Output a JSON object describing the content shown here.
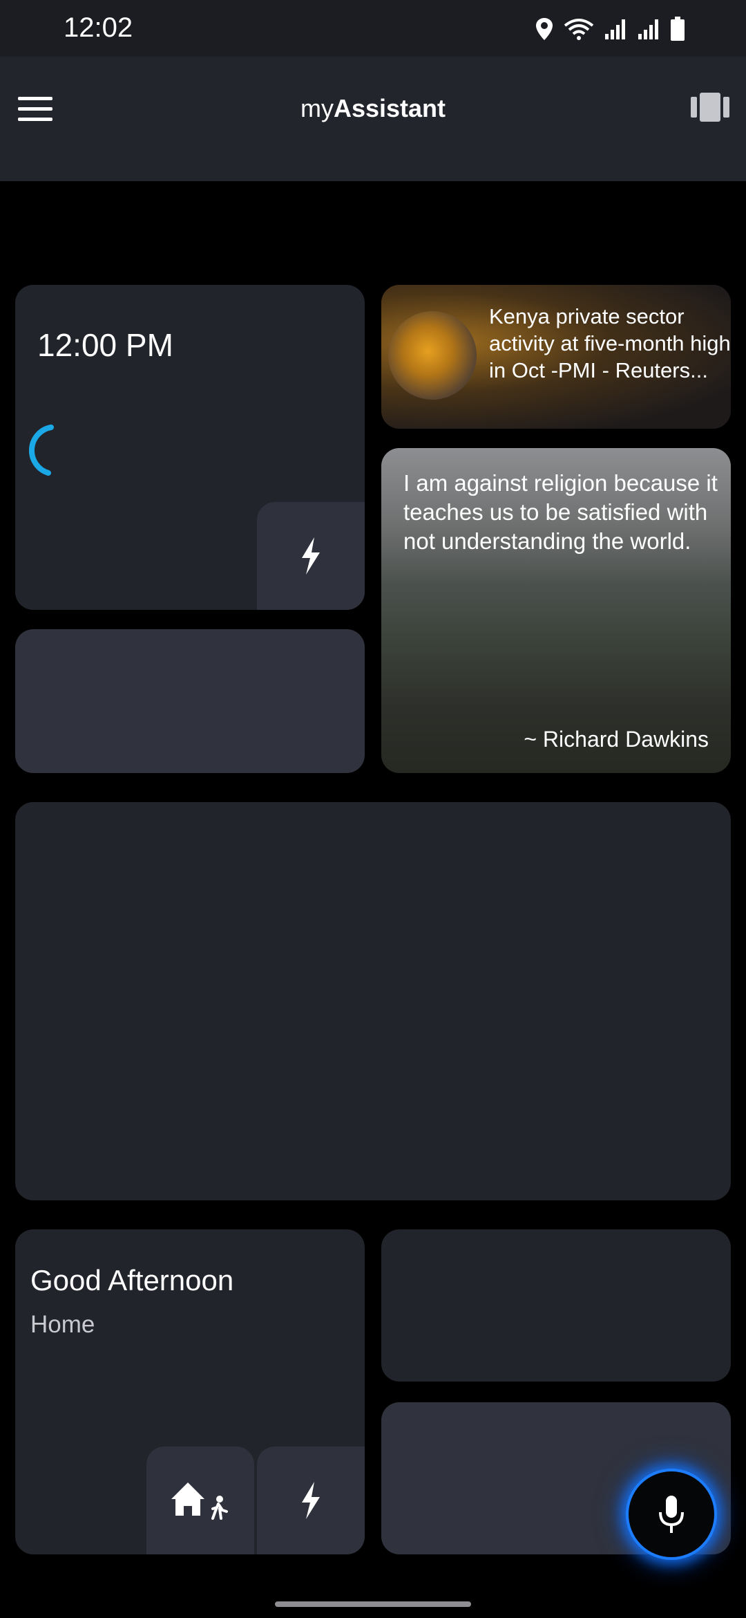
{
  "status_bar": {
    "time": "12:02",
    "icons": [
      "location-icon",
      "wifi-icon",
      "signal-icon",
      "signal-icon",
      "battery-icon"
    ]
  },
  "app_bar": {
    "title_prefix": "my",
    "title_bold": "Assistant",
    "left_icon": "menu-icon",
    "right_icon": "carousel-icon"
  },
  "clock_card": {
    "time": "12:00 PM",
    "action_icon": "lightning-icon"
  },
  "news_card": {
    "headline": "Kenya private sector activity at five-month high in Oct -PMI - Reuters..."
  },
  "quote_card": {
    "text": "I am against religion because it teaches us to be satisfied with not understanding the world.",
    "author": "~ Richard Dawkins"
  },
  "greeting_card": {
    "title": "Good Afternoon",
    "location": "Home",
    "buttons": [
      "home-person-icon",
      "lightning-icon"
    ]
  },
  "fab": {
    "icon": "microphone-icon",
    "accent": "#1d7dff"
  },
  "colors": {
    "spinner": "#1aa9e6",
    "card_dark": "#22242c",
    "card_light": "#30333d"
  }
}
